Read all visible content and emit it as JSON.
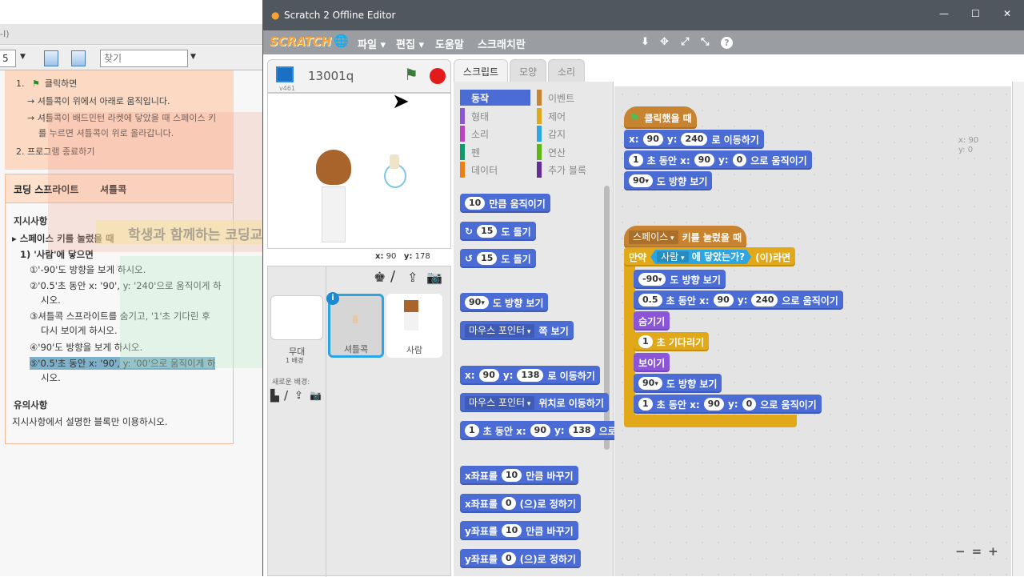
{
  "doc": {
    "menu_fragment": "-I)",
    "zoom_value": "5",
    "search_placeholder": "찾기",
    "steps": [
      {
        "num": "1.",
        "text": "클릭하면"
      },
      {
        "text": "→ 셔틀콕이 위에서 아래로 움직입니다."
      },
      {
        "text": "→ 셔틀콕이 배드민턴 라켓에 닿았을 때 스페이스 키"
      },
      {
        "text": "를 누르면 셔틀콕이 위로 올라갑니다."
      },
      {
        "num": "2.",
        "text": "프로그램 종료하기"
      }
    ],
    "table_header": [
      "코딩 스프라이트",
      "셔틀콕"
    ],
    "instructions_title": "지시사항",
    "instructions": [
      "▸ 스페이스 키를 눌렀을 때",
      "1) '사람'에 닿으면",
      "①'-90'도 방향을 보게 하시오.",
      "②'0.5'초 동안 x: '90', y: '240'으로 움직이게 하",
      "시오.",
      "③셔틀콕 스프라이트를 숨기고, '1'초 기다린 후",
      "다시 보이게 하시오.",
      "④'90'도 방향을 보게 하시오.",
      "⑤'0.5'초 동안 x: '90', y: '00'으로 움직이게 하",
      "시오."
    ],
    "notes_title": "유의사항",
    "notes": "지시사항에서 설명한 블록만 이용하시오.",
    "watermark": "학생과 함께하는 코딩교육 전문가"
  },
  "window": {
    "title": "Scratch 2 Offline Editor",
    "controls": [
      "—",
      "☐",
      "✕"
    ]
  },
  "menu": {
    "logo": "SCRATCH",
    "items": [
      "파일 ▾",
      "편집 ▾",
      "도움말",
      "스크래치란"
    ],
    "tools": [
      "⬇",
      "✥",
      "⤢",
      "⤡",
      "?"
    ]
  },
  "stage": {
    "project_name": "13001q",
    "version": "v461",
    "x_label": "x:",
    "x": "90",
    "y_label": "y:",
    "y": "178"
  },
  "sprites": {
    "stage_label": "무대",
    "stage_sub": "1 배경",
    "new_backdrop": "새로운 배경:",
    "items": [
      {
        "name": "셔틀콕",
        "selected": true
      },
      {
        "name": "사람",
        "selected": false
      }
    ]
  },
  "tabs": [
    "스크립트",
    "모양",
    "소리"
  ],
  "categories": [
    {
      "label": "동작",
      "color": "#4a6cd4",
      "active": true
    },
    {
      "label": "이벤트",
      "color": "#c88330"
    },
    {
      "label": "형태",
      "color": "#8a55d7"
    },
    {
      "label": "제어",
      "color": "#e1a91a"
    },
    {
      "label": "소리",
      "color": "#bb42c3"
    },
    {
      "label": "감지",
      "color": "#2ca5e2"
    },
    {
      "label": "펜",
      "color": "#0e9a6c"
    },
    {
      "label": "연산",
      "color": "#5cb712"
    },
    {
      "label": "데이터",
      "color": "#ee7d16"
    },
    {
      "label": "추가 블록",
      "color": "#632d99"
    }
  ],
  "colors": {
    "motion": "#4a6cd4",
    "events": "#c88330",
    "looks": "#8a55d7",
    "control": "#e1a91a",
    "sensing": "#2ca5e2"
  },
  "palette_blocks": [
    [
      {
        "i": "10"
      },
      {
        "t": "만큼 움직이기"
      }
    ],
    [
      {
        "t": "↻"
      },
      {
        "i": "15"
      },
      {
        "t": "도 돌기"
      }
    ],
    [
      {
        "t": "↺"
      },
      {
        "i": "15"
      },
      {
        "t": "도 돌기"
      }
    ],
    [
      {
        "i": "90",
        "d": 1
      },
      {
        "t": "도 방향 보기"
      }
    ],
    [
      {
        "dd": "마우스 포인터"
      },
      {
        "t": "쪽 보기"
      }
    ],
    [
      {
        "t": "x:"
      },
      {
        "i": "90"
      },
      {
        "t": "y:"
      },
      {
        "i": "138"
      },
      {
        "t": "로 이동하기"
      }
    ],
    [
      {
        "dd": "마우스 포인터"
      },
      {
        "t": "위치로 이동하기"
      }
    ],
    [
      {
        "i": "1"
      },
      {
        "t": "초 동안 x:"
      },
      {
        "i": "90"
      },
      {
        "t": "y:"
      },
      {
        "i": "138"
      },
      {
        "t": "으로 움직이기"
      }
    ],
    [
      {
        "t": "x좌표를"
      },
      {
        "i": "10"
      },
      {
        "t": "만큼 바꾸기"
      }
    ],
    [
      {
        "t": "x좌표를"
      },
      {
        "i": "0"
      },
      {
        "t": "(으)로 정하기"
      }
    ],
    [
      {
        "t": "y좌표를"
      },
      {
        "i": "10"
      },
      {
        "t": "만큼 바꾸기"
      }
    ],
    [
      {
        "t": "y좌표를"
      },
      {
        "i": "0"
      },
      {
        "t": "(으)로 정하기"
      }
    ]
  ],
  "scripts": [
    {
      "c": "events",
      "hat": true,
      "flag": true,
      "p": [
        {
          "t": "클릭했을 때"
        }
      ]
    },
    {
      "c": "motion",
      "p": [
        {
          "t": "x:"
        },
        {
          "i": "90"
        },
        {
          "t": "y:"
        },
        {
          "i": "240"
        },
        {
          "t": "로 이동하기"
        }
      ]
    },
    {
      "c": "motion",
      "p": [
        {
          "i": "1"
        },
        {
          "t": "초 동안 x:"
        },
        {
          "i": "90"
        },
        {
          "t": "y:"
        },
        {
          "i": "0"
        },
        {
          "t": "으로 움직이기"
        }
      ]
    },
    {
      "c": "motion",
      "p": [
        {
          "i": "90",
          "d": 1
        },
        {
          "t": "도 방향 보기"
        }
      ]
    },
    {
      "c": "events",
      "hat": true,
      "p": [
        {
          "dd": "스페이스"
        },
        {
          "t": "키를 눌렀을 때"
        }
      ]
    },
    {
      "c": "control",
      "p": [
        {
          "t": "만약"
        },
        {
          "s": "사람",
          "st": "에 닿았는가?"
        },
        {
          "t": "(이)라면"
        }
      ]
    },
    {
      "c": "motion",
      "p": [
        {
          "i": "-90",
          "d": 1
        },
        {
          "t": "도 방향 보기"
        }
      ]
    },
    {
      "c": "motion",
      "p": [
        {
          "i": "0.5"
        },
        {
          "t": "초 동안 x:"
        },
        {
          "i": "90"
        },
        {
          "t": "y:"
        },
        {
          "i": "240"
        },
        {
          "t": "으로 움직이기"
        }
      ]
    },
    {
      "c": "looks",
      "p": [
        {
          "t": "숨기기"
        }
      ]
    },
    {
      "c": "control",
      "p": [
        {
          "i": "1"
        },
        {
          "t": "초 기다리기"
        }
      ]
    },
    {
      "c": "looks",
      "p": [
        {
          "t": "보이기"
        }
      ]
    },
    {
      "c": "motion",
      "p": [
        {
          "i": "90",
          "d": 1
        },
        {
          "t": "도 방향 보기"
        }
      ]
    },
    {
      "c": "motion",
      "p": [
        {
          "i": "1"
        },
        {
          "t": "초 동안 x:"
        },
        {
          "i": "90"
        },
        {
          "t": "y:"
        },
        {
          "i": "0"
        },
        {
          "t": "으로 움직이기"
        }
      ]
    }
  ],
  "mouse_readout": {
    "x": "x: 90",
    "y": "y: 0"
  },
  "zoom_controls": [
    "−",
    "=",
    "+"
  ]
}
